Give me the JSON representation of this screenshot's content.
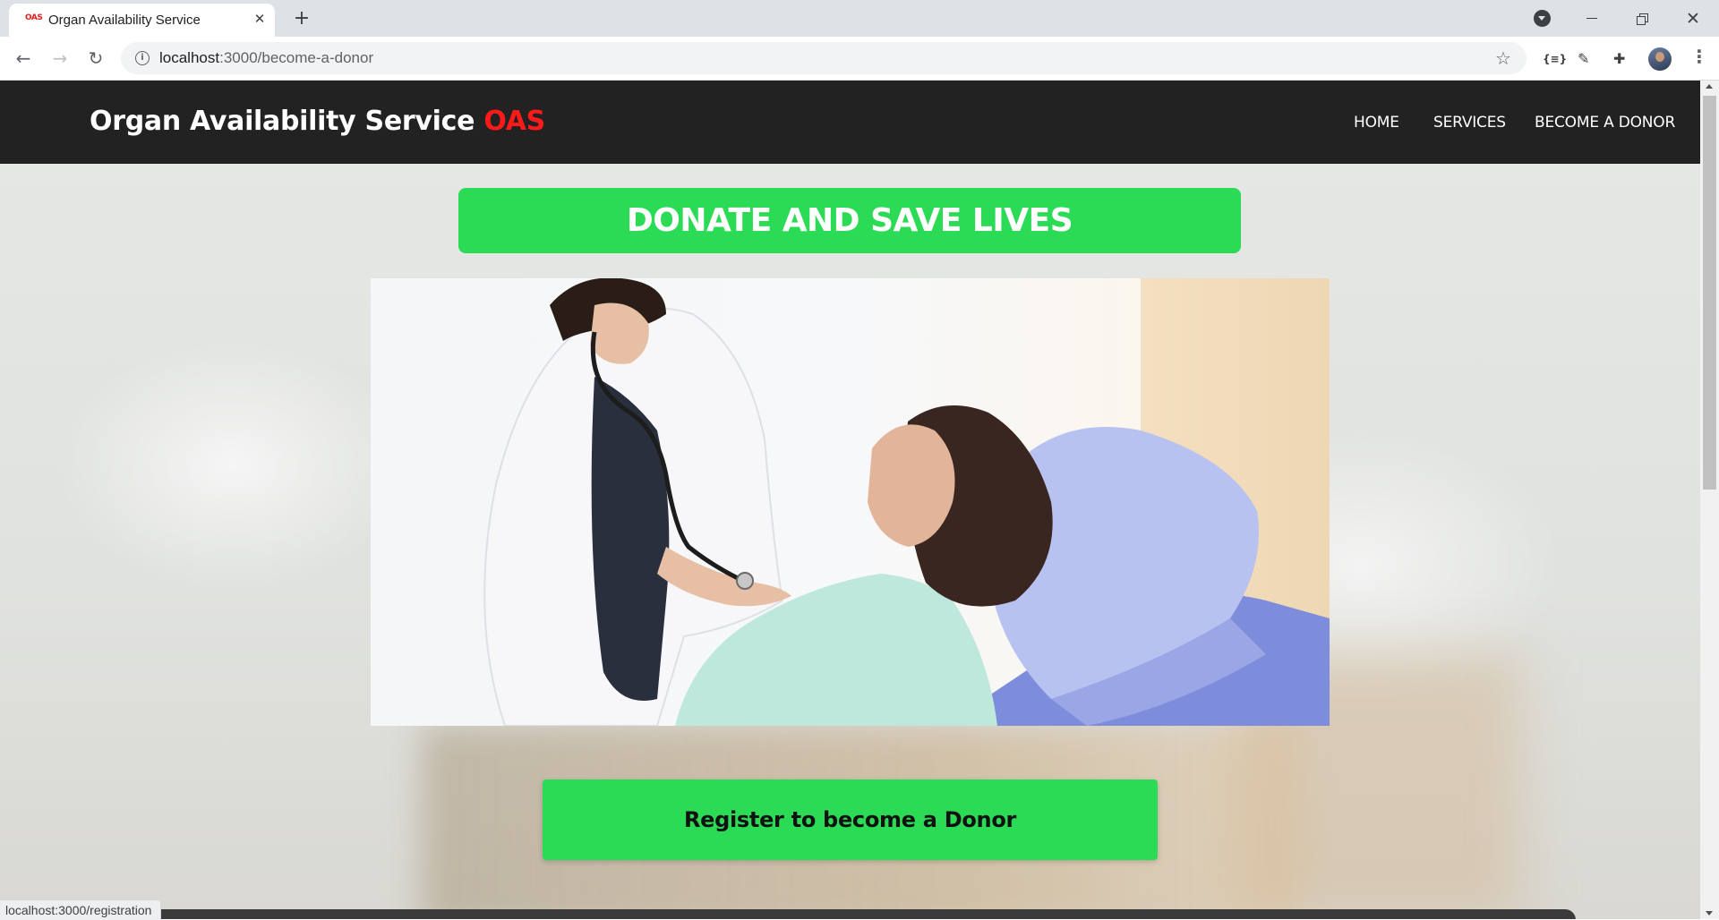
{
  "browser": {
    "tab": {
      "favicon_text": "OAS",
      "title": "Organ Availability Service",
      "close_icon": "close-icon"
    },
    "new_tab_icon": "plus-icon",
    "address_bar": {
      "host": "localhost",
      "path": ":3000/become-a-donor"
    },
    "status_url": "localhost:3000/registration",
    "extension_json_label": "{≡}"
  },
  "site": {
    "brand": {
      "name": "Organ Availability Service",
      "accent": "OAS",
      "accent_color": "#ff1a1a"
    },
    "nav": {
      "home": "HOME",
      "services": "SERVICES",
      "become_donor": "BECOME A DONOR"
    },
    "headline": "DONATE AND SAVE LIVES",
    "register_button": "Register to become a Donor",
    "accent_green": "#2bdb55",
    "navbar_color": "#222222"
  }
}
